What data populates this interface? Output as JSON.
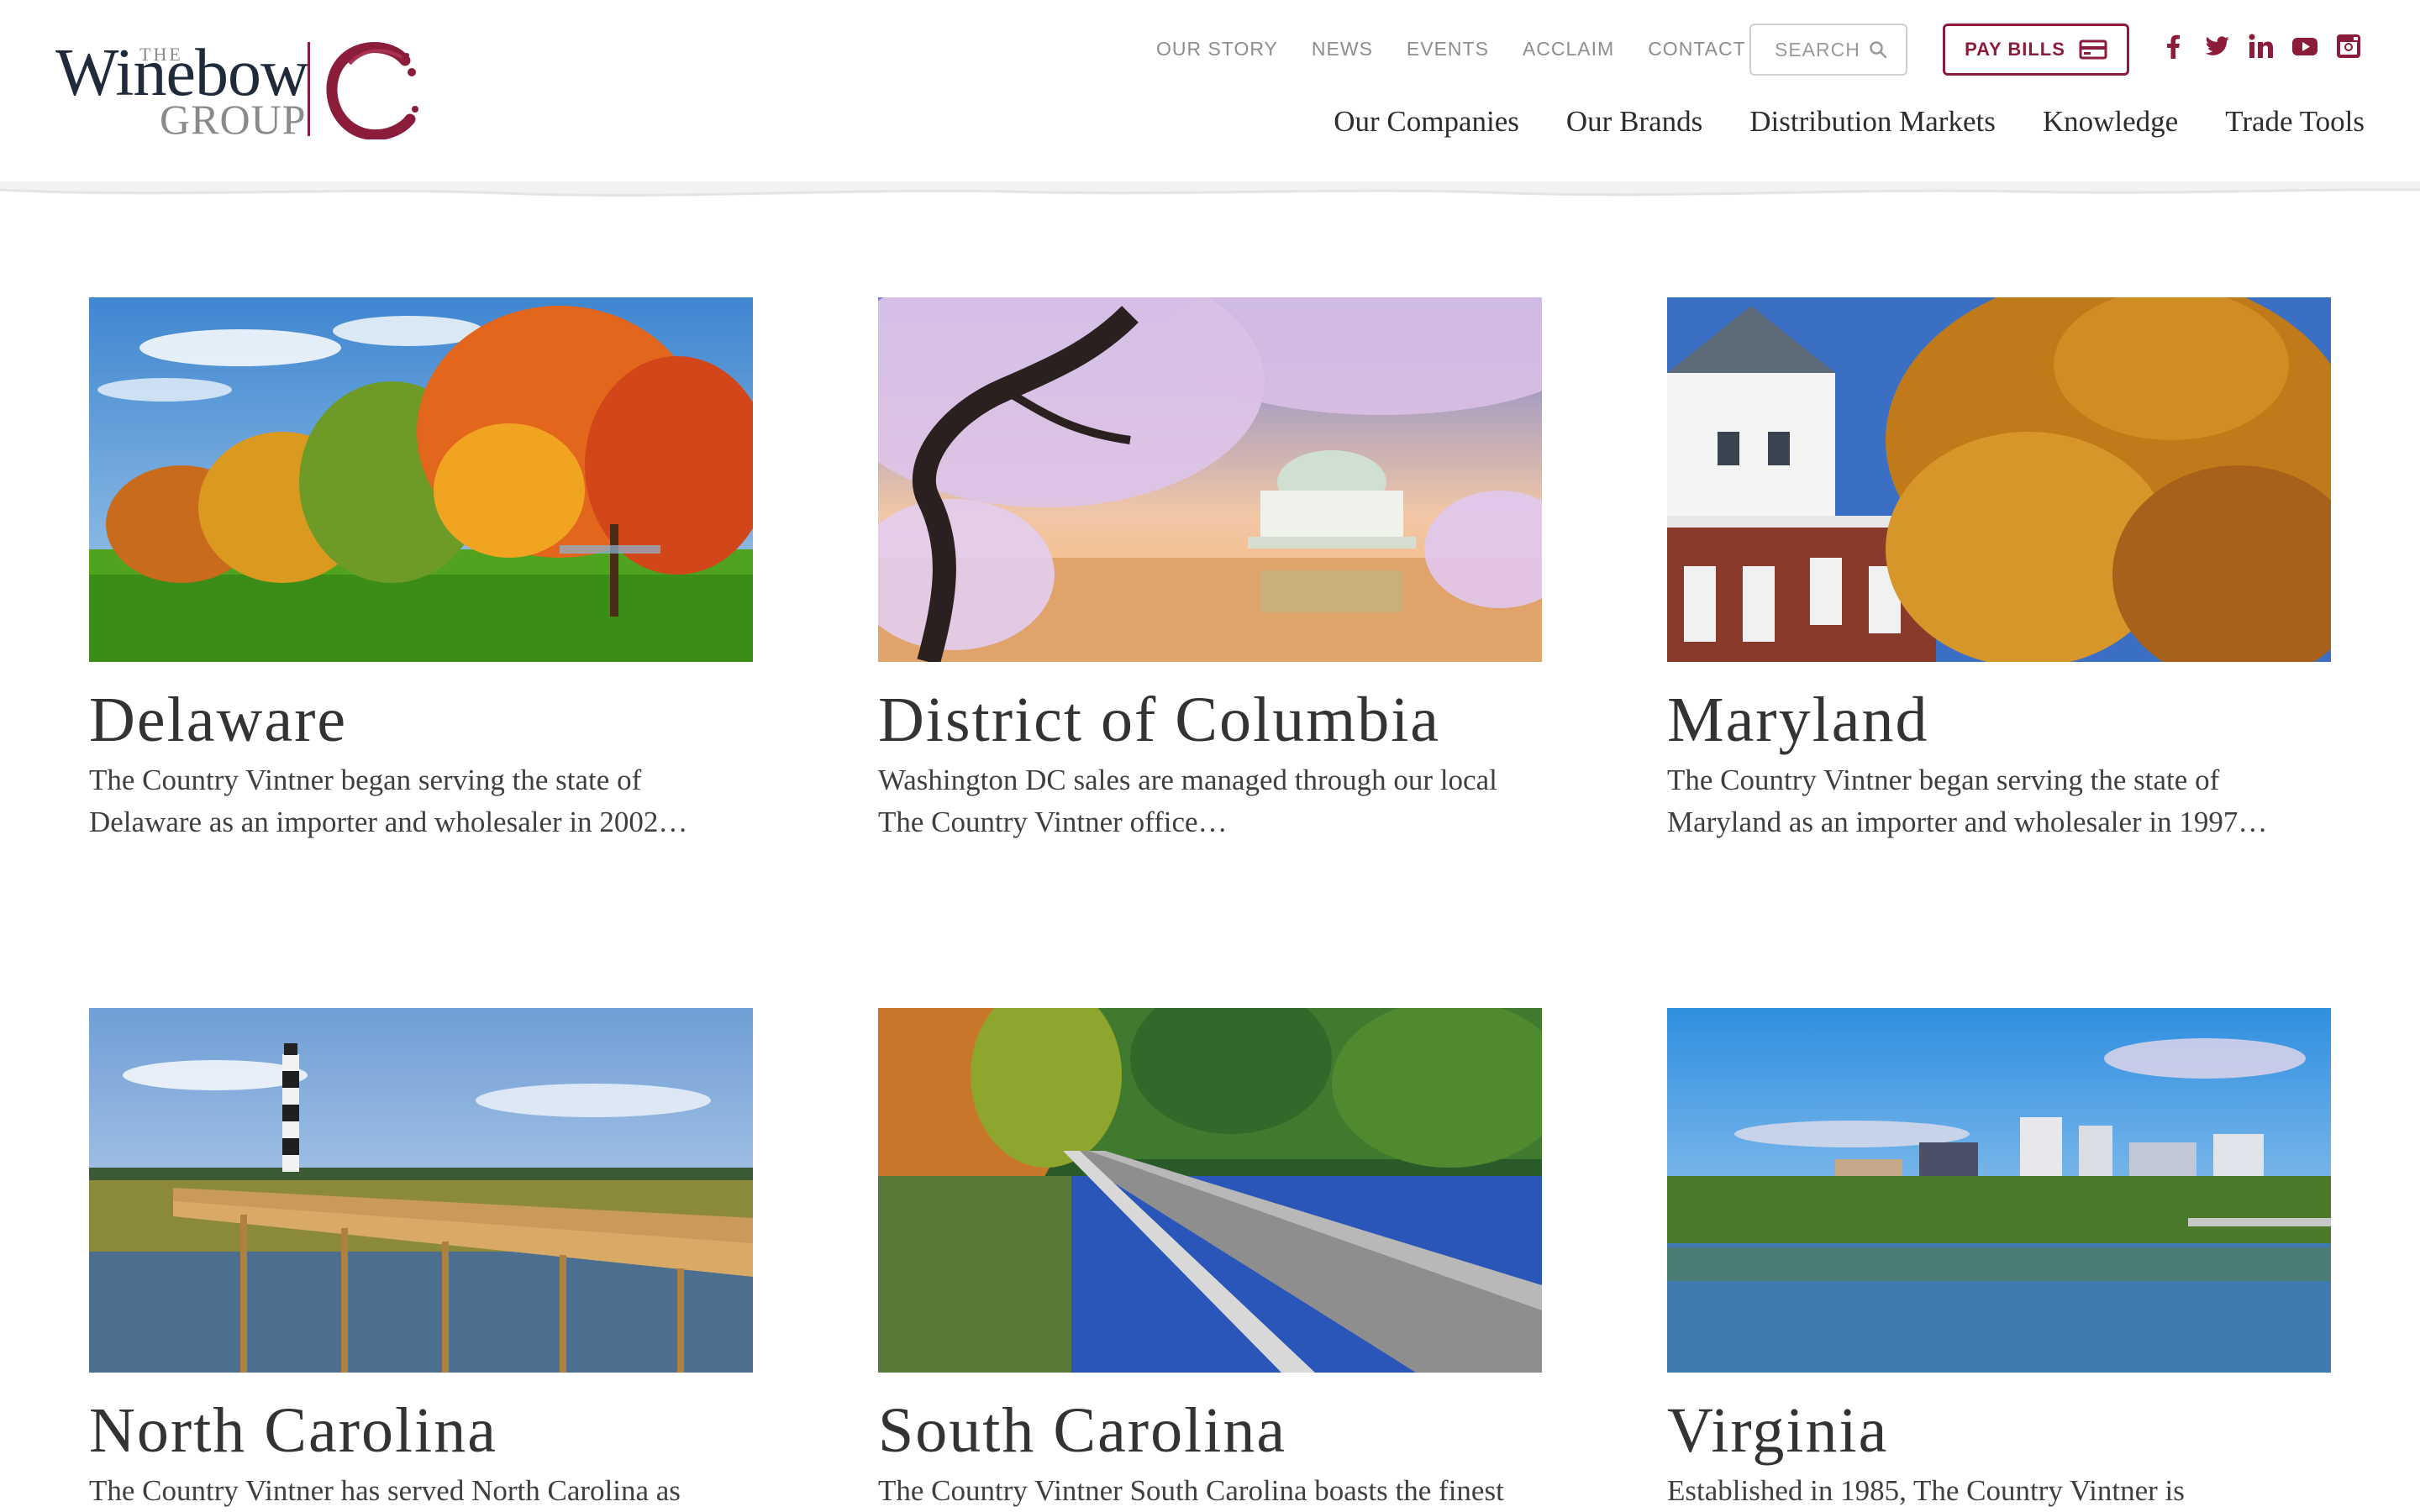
{
  "header": {
    "logo": {
      "the": "THE",
      "brand": "Winebow",
      "group": "GROUP"
    },
    "utility_nav": [
      "OUR STORY",
      "NEWS",
      "EVENTS",
      "ACCLAIM",
      "CONTACT"
    ],
    "search_placeholder": "SEARCH",
    "pay_bills_label": "PAY BILLS",
    "social_icons": [
      "facebook-icon",
      "twitter-icon",
      "linkedin-icon",
      "youtube-icon",
      "instagram-icon"
    ],
    "main_nav": [
      "Our Companies",
      "Our Brands",
      "Distribution Markets",
      "Knowledge",
      "Trade Tools"
    ]
  },
  "colors": {
    "brand": "#8b1d3a",
    "text": "#333333",
    "muted": "#8d8d8d"
  },
  "markets": [
    {
      "name": "Delaware",
      "description": "The Country Vintner began serving the state of Delaware as an importer and wholesaler in 2002…",
      "image": "autumn-park"
    },
    {
      "name": "District of Columbia",
      "description": "Washington DC sales are managed through our local The Country Vintner office…",
      "image": "jefferson-memorial-cherry-blossoms"
    },
    {
      "name": "Maryland",
      "description": "The Country Vintner began serving the state of Maryland as an importer and wholesaler in 1997…",
      "image": "state-house-autumn"
    },
    {
      "name": "North Carolina",
      "description": "The Country Vintner has served North Carolina as",
      "image": "lighthouse-boardwalk"
    },
    {
      "name": "South Carolina",
      "description": "The Country Vintner South Carolina boasts the finest",
      "image": "lake-boardwalk"
    },
    {
      "name": "Virginia",
      "description": "Established in 1985, The Country Vintner is",
      "image": "skyline-river"
    }
  ]
}
